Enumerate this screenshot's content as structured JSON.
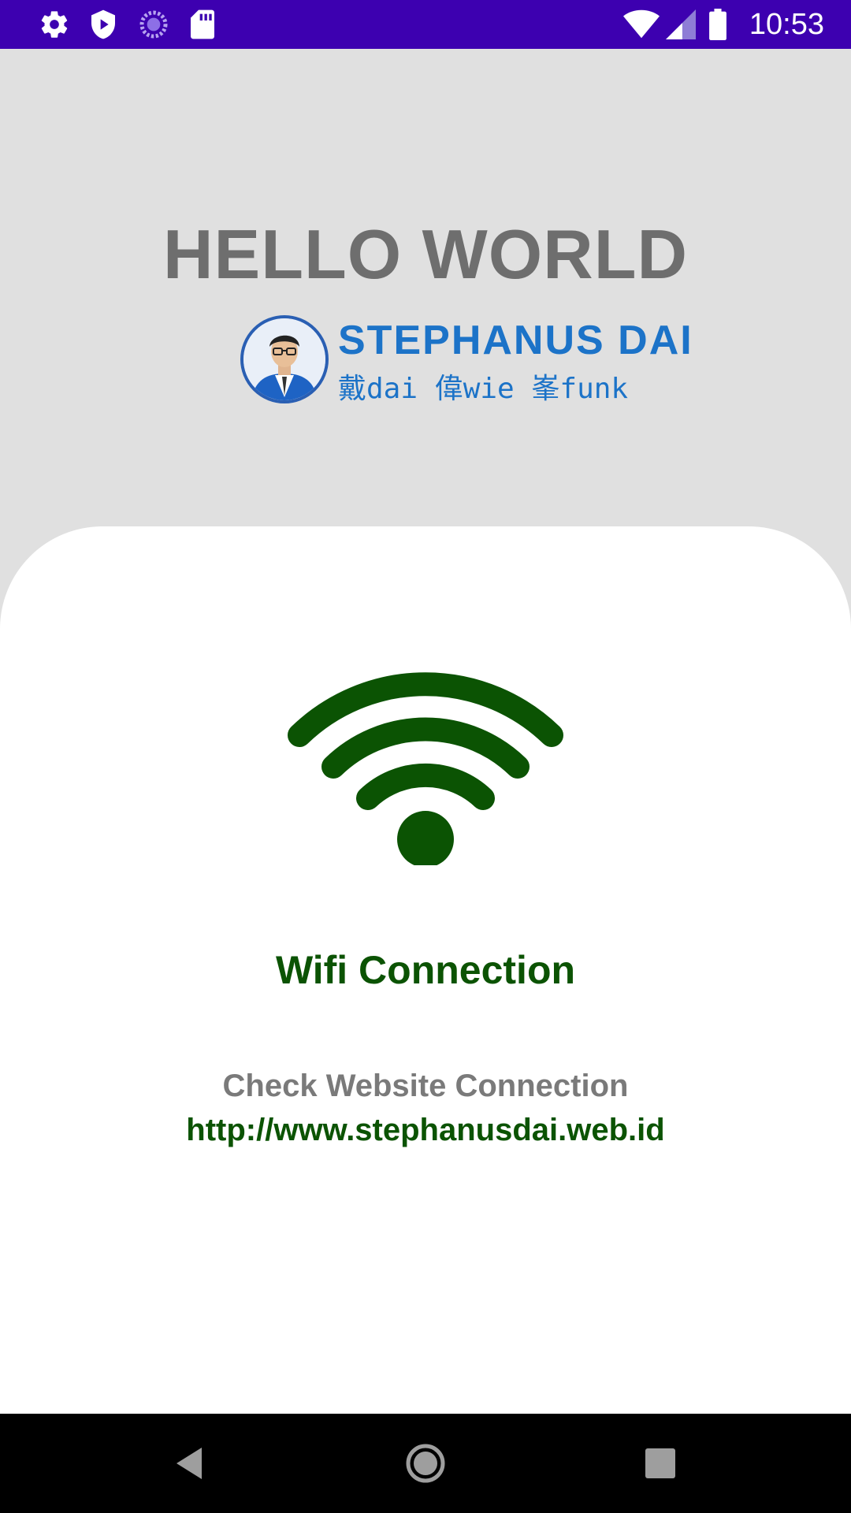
{
  "status_bar": {
    "time": "10:53",
    "icons_left": [
      "settings-icon",
      "shield-play-icon",
      "loading-circle-icon",
      "sd-card-icon"
    ],
    "icons_right": [
      "wifi-signal-icon",
      "cell-signal-icon",
      "battery-icon"
    ]
  },
  "header": {
    "title": "HELLO WORLD",
    "logo": {
      "name": "STEPHANUS DAI",
      "subtitle": "戴dai 偉wie 峯funk"
    }
  },
  "card": {
    "icon": "wifi-icon",
    "title": "Wifi Connection",
    "check_label": "Check Website Connection",
    "url": "http://www.stephanusdai.web.id"
  },
  "nav_bar": {
    "buttons": [
      "back-icon",
      "home-icon",
      "recents-icon"
    ]
  },
  "colors": {
    "status_bar": "#3d00b0",
    "header_bg": "#e0e0e0",
    "accent_green": "#0b5303",
    "gray_text": "#6e6e6e",
    "logo_blue": "#1c73c8"
  }
}
